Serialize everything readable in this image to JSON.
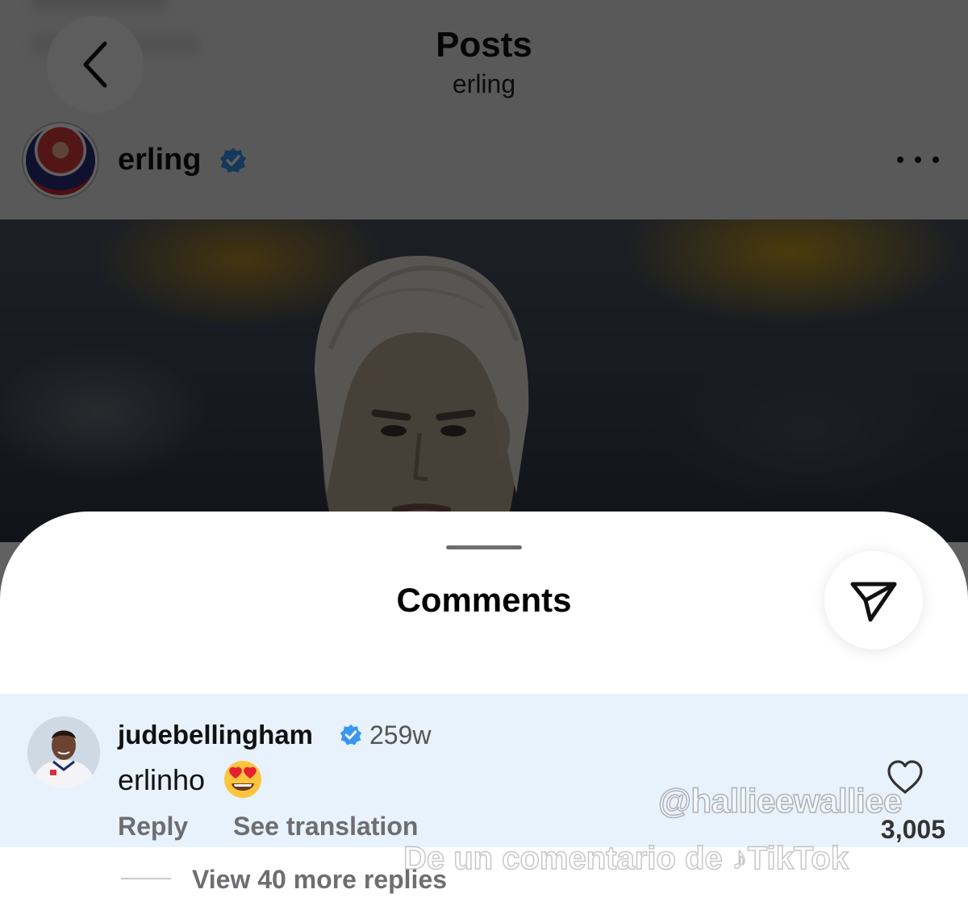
{
  "header": {
    "title": "Posts",
    "subtitle": "erling",
    "back_icon": "chevron-left-icon"
  },
  "post": {
    "username": "erling",
    "verified": true,
    "more_icon": "ellipsis-icon"
  },
  "comments_sheet": {
    "title": "Comments",
    "share_icon": "send-icon"
  },
  "comment": {
    "username": "judebellingham",
    "verified": true,
    "time": "259w",
    "text": "erlinho",
    "emoji": "heart-eyes-emoji",
    "reply_label": "Reply",
    "translate_label": "See translation",
    "like_count": "3,005",
    "like_icon": "heart-icon",
    "view_replies_label": "View 40 more replies"
  },
  "watermark": {
    "handle": "@hallieewalliee",
    "caption": "De un comentario de",
    "brand": "TikTok"
  },
  "colors": {
    "verified_blue": "#3797f0",
    "comment_highlight": "#e7f2fc",
    "overlay": "rgba(0,0,0,0.62)"
  }
}
